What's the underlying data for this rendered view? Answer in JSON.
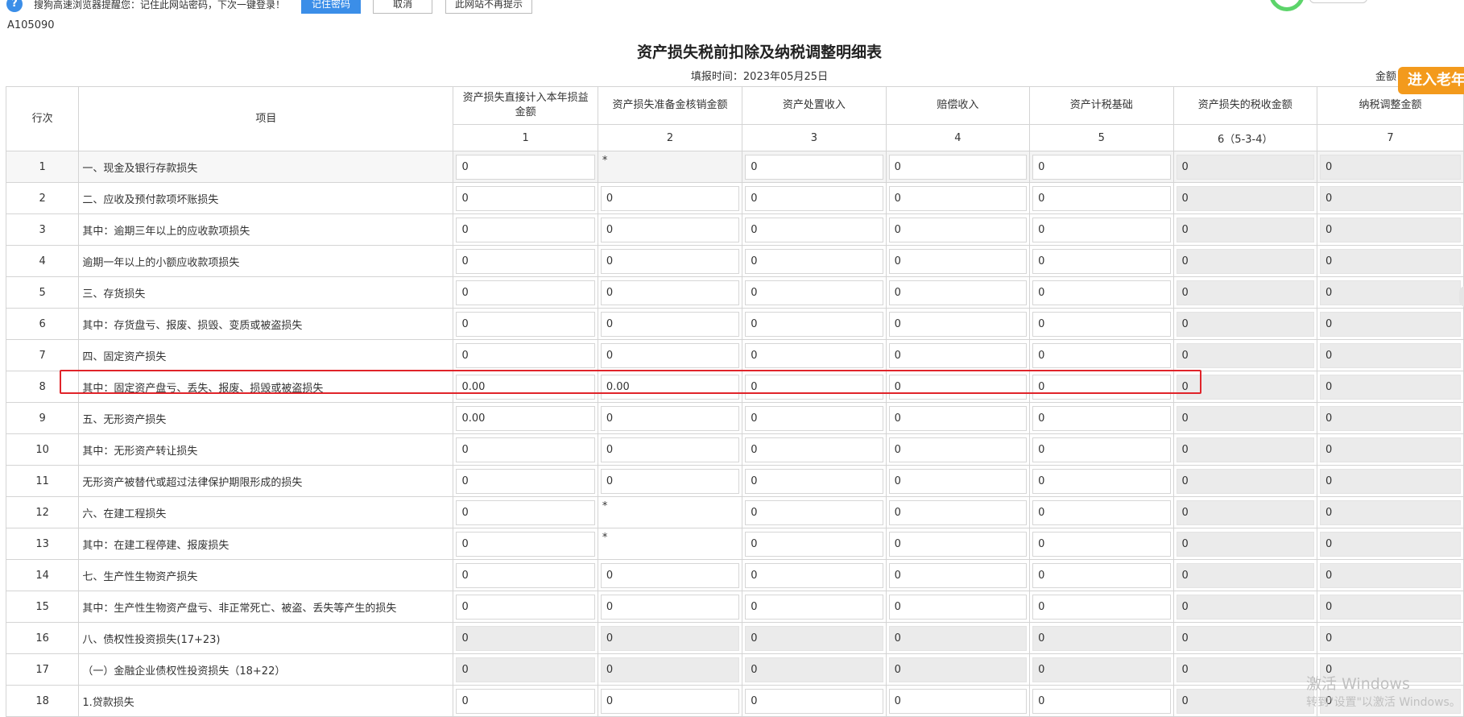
{
  "browser_bar": {
    "message": "搜狗高速浏览器提醒您：记住此网站密码，下次一键登录！",
    "remember_label": "记住密码",
    "cancel_label": "取消",
    "never_label": "此网站不再提示"
  },
  "form": {
    "code": "A105090",
    "title": "资产损失税前扣除及纳税调整明细表",
    "fill_date": "填报时间：2023年05月25日",
    "amount_unit": "金额",
    "elder_mode_label": "进入老年"
  },
  "table": {
    "headers": [
      "行次",
      "项目",
      "资产损失直接计入本年损益金额",
      "资产损失准备金核销金额",
      "资产处置收入",
      "赔偿收入",
      "资产计税基础",
      "资产损失的税收金额",
      "纳税调整金额"
    ],
    "col_numbers": [
      "1",
      "2",
      "3",
      "4",
      "5",
      "6（5-3-4）",
      "7"
    ],
    "rows": [
      {
        "no": "1",
        "item": "一、现金及银行存款损失",
        "cells": [
          "0",
          "*",
          "0",
          "0",
          "0",
          "0",
          "0"
        ]
      },
      {
        "no": "2",
        "item": "二、应收及预付款项坏账损失",
        "cells": [
          "0",
          "0",
          "0",
          "0",
          "0",
          "0",
          "0"
        ]
      },
      {
        "no": "3",
        "item": "其中：逾期三年以上的应收款项损失",
        "cells": [
          "0",
          "0",
          "0",
          "0",
          "0",
          "0",
          "0"
        ]
      },
      {
        "no": "4",
        "item": "逾期一年以上的小额应收款项损失",
        "cells": [
          "0",
          "0",
          "0",
          "0",
          "0",
          "0",
          "0"
        ]
      },
      {
        "no": "5",
        "item": "三、存货损失",
        "cells": [
          "0",
          "0",
          "0",
          "0",
          "0",
          "0",
          "0"
        ]
      },
      {
        "no": "6",
        "item": "其中：存货盘亏、报废、损毁、变质或被盗损失",
        "cells": [
          "0",
          "0",
          "0",
          "0",
          "0",
          "0",
          "0"
        ]
      },
      {
        "no": "7",
        "item": "四、固定资产损失",
        "cells": [
          "0",
          "0",
          "0",
          "0",
          "0",
          "0",
          "0"
        ]
      },
      {
        "no": "8",
        "item": "其中：固定资产盘亏、丢失、报废、损毁或被盗损失",
        "cells": [
          "0.00",
          "0.00",
          "0",
          "0",
          "0",
          "0",
          "0"
        ]
      },
      {
        "no": "9",
        "item": "五、无形资产损失",
        "cells": [
          "0.00",
          "0",
          "0",
          "0",
          "0",
          "0",
          "0"
        ]
      },
      {
        "no": "10",
        "item": "其中：无形资产转让损失",
        "cells": [
          "0",
          "0",
          "0",
          "0",
          "0",
          "0",
          "0"
        ]
      },
      {
        "no": "11",
        "item": "无形资产被替代或超过法律保护期限形成的损失",
        "cells": [
          "0",
          "0",
          "0",
          "0",
          "0",
          "0",
          "0"
        ]
      },
      {
        "no": "12",
        "item": "六、在建工程损失",
        "cells": [
          "0",
          "*",
          "0",
          "0",
          "0",
          "0",
          "0"
        ]
      },
      {
        "no": "13",
        "item": "其中：在建工程停建、报废损失",
        "cells": [
          "0",
          "*",
          "0",
          "0",
          "0",
          "0",
          "0"
        ]
      },
      {
        "no": "14",
        "item": "七、生产性生物资产损失",
        "cells": [
          "0",
          "0",
          "0",
          "0",
          "0",
          "0",
          "0"
        ]
      },
      {
        "no": "15",
        "item": "其中：生产性生物资产盘亏、非正常死亡、被盗、丢失等产生的损失",
        "cells": [
          "0",
          "0",
          "0",
          "0",
          "0",
          "0",
          "0"
        ]
      },
      {
        "no": "16",
        "item": "八、债权性投资损失(17+23)",
        "cells": [
          "0",
          "0",
          "0",
          "0",
          "0",
          "0",
          "0"
        ]
      },
      {
        "no": "17",
        "item": "（一）金融企业债权性投资损失（18+22）",
        "cells": [
          "0",
          "0",
          "0",
          "0",
          "0",
          "0",
          "0"
        ]
      },
      {
        "no": "18",
        "item": "1.贷款损失",
        "cells": [
          "0",
          "0",
          "0",
          "0",
          "0",
          "0",
          "0"
        ]
      }
    ]
  },
  "watermark": {
    "line1": "激活 Windows",
    "line2": "转到\"设置\"以激活 Windows。"
  }
}
